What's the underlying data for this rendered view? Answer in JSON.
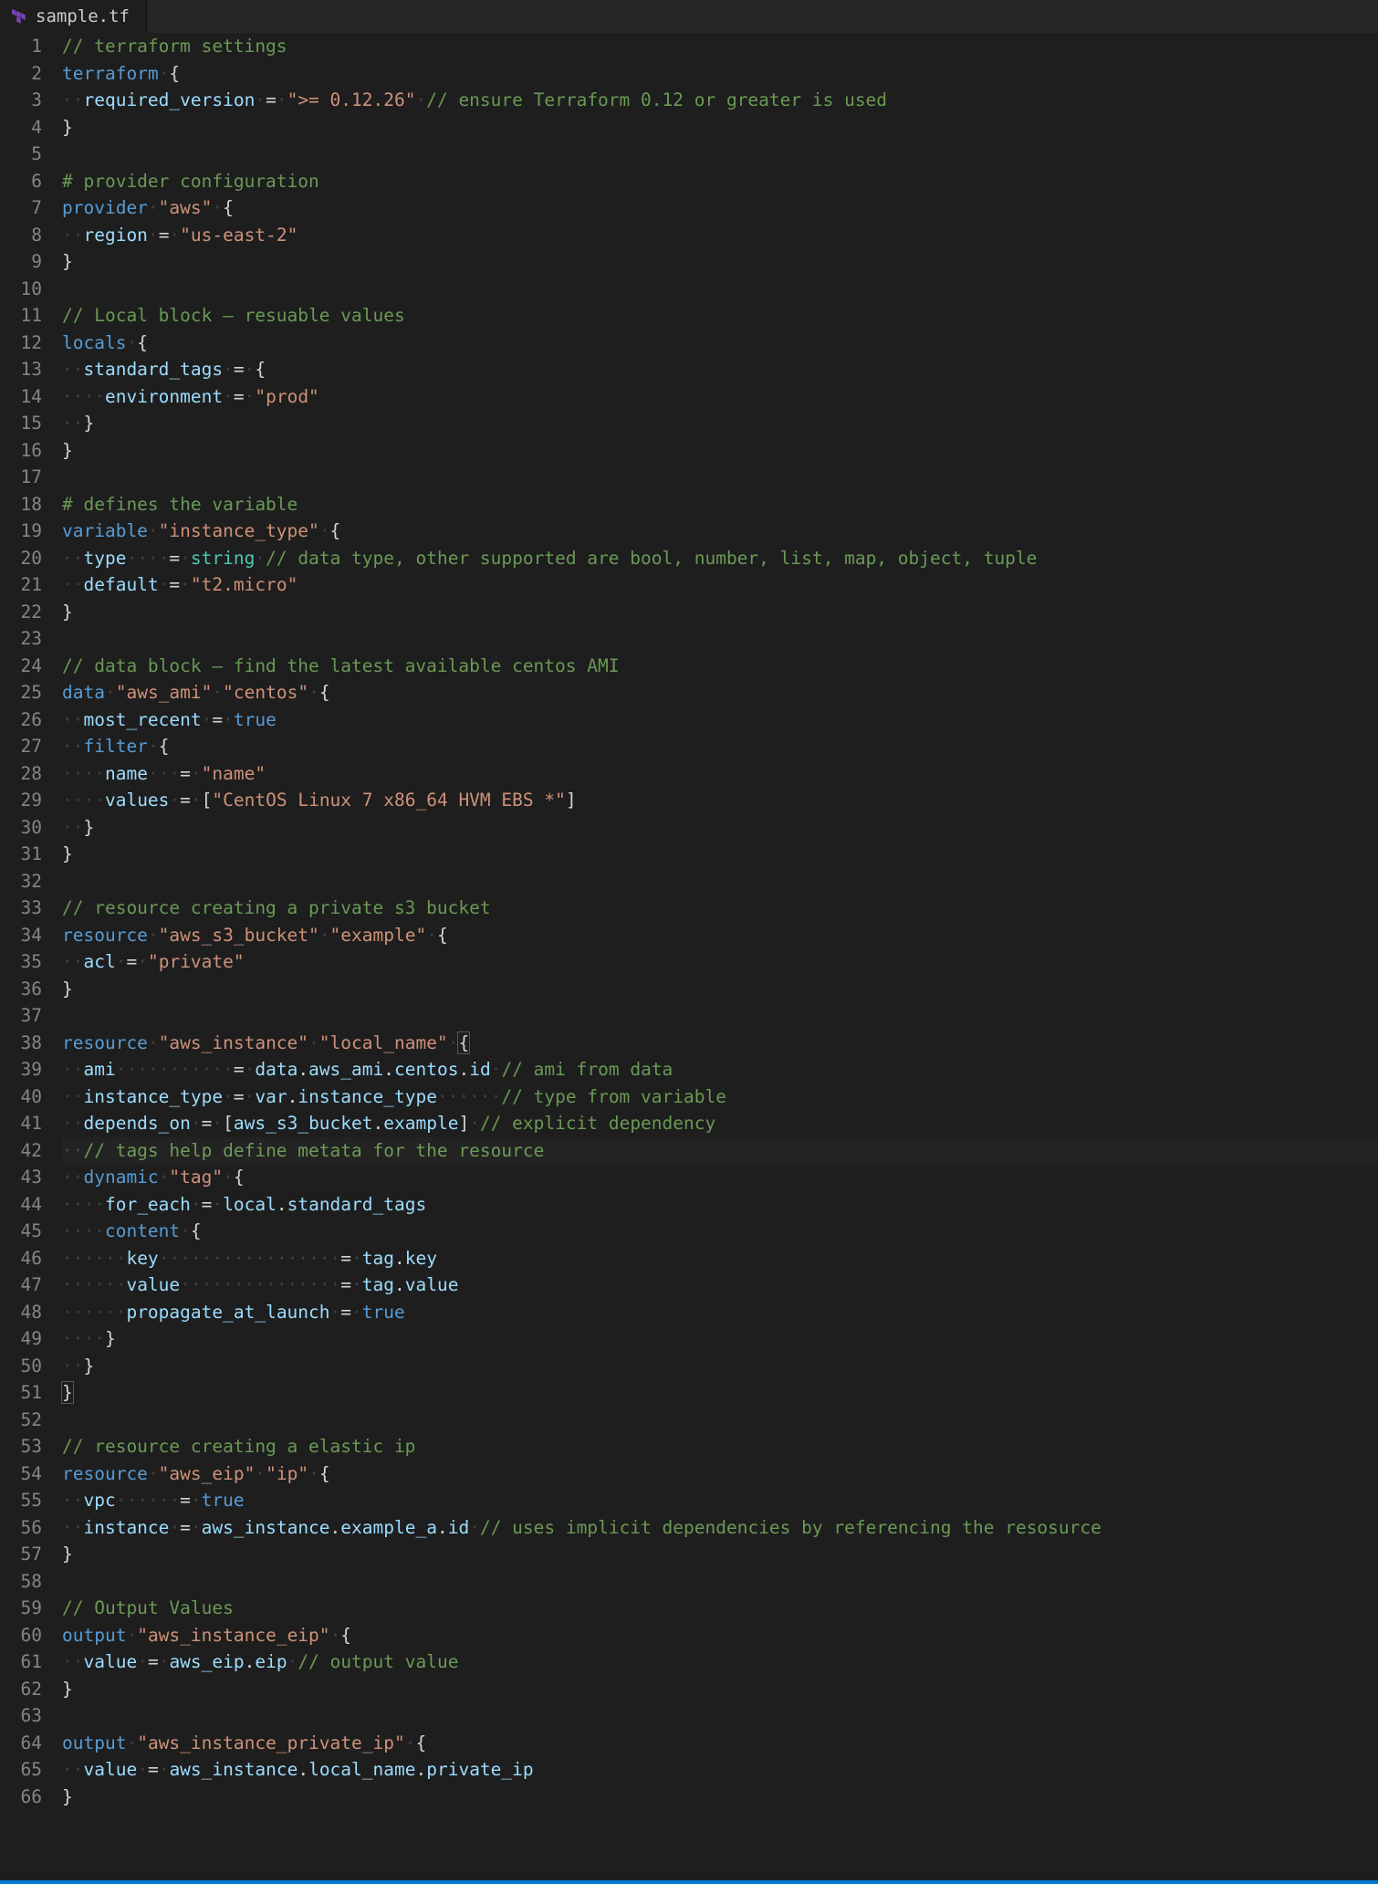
{
  "tab": {
    "filename": "sample.tf"
  },
  "highlight_line": 42,
  "lines": [
    [
      [
        "c-comment",
        "// terraform settings"
      ]
    ],
    [
      [
        "c-keyword",
        "terraform"
      ],
      [
        "ws",
        " "
      ],
      [
        "c-punct",
        "{"
      ]
    ],
    [
      [
        "ws",
        "··"
      ],
      [
        "c-prop",
        "required_version"
      ],
      [
        "ws",
        " "
      ],
      [
        "c-op",
        "="
      ],
      [
        "ws",
        " "
      ],
      [
        "c-string",
        "\">= 0.12.26\""
      ],
      [
        "ws",
        " "
      ],
      [
        "c-comment",
        "// ensure Terraform 0.12 or greater is used"
      ]
    ],
    [
      [
        "c-punct",
        "}"
      ]
    ],
    [
      [
        "",
        ""
      ]
    ],
    [
      [
        "c-comment",
        "# provider configuration"
      ]
    ],
    [
      [
        "c-keyword",
        "provider"
      ],
      [
        "ws",
        " "
      ],
      [
        "c-string",
        "\"aws\""
      ],
      [
        "ws",
        " "
      ],
      [
        "c-punct",
        "{"
      ]
    ],
    [
      [
        "ws",
        "··"
      ],
      [
        "c-prop",
        "region"
      ],
      [
        "ws",
        " "
      ],
      [
        "c-op",
        "="
      ],
      [
        "ws",
        " "
      ],
      [
        "c-string",
        "\"us-east-2\""
      ]
    ],
    [
      [
        "c-punct",
        "}"
      ]
    ],
    [
      [
        "",
        ""
      ]
    ],
    [
      [
        "c-comment",
        "// Local block – resuable values"
      ]
    ],
    [
      [
        "c-keyword",
        "locals"
      ],
      [
        "ws",
        " "
      ],
      [
        "c-punct",
        "{"
      ]
    ],
    [
      [
        "ws",
        "··"
      ],
      [
        "c-prop",
        "standard_tags"
      ],
      [
        "ws",
        " "
      ],
      [
        "c-op",
        "="
      ],
      [
        "ws",
        " "
      ],
      [
        "c-punct",
        "{"
      ]
    ],
    [
      [
        "ws",
        "····"
      ],
      [
        "c-prop",
        "environment"
      ],
      [
        "ws",
        " "
      ],
      [
        "c-op",
        "="
      ],
      [
        "ws",
        " "
      ],
      [
        "c-string",
        "\"prod\""
      ]
    ],
    [
      [
        "ws",
        "··"
      ],
      [
        "c-punct",
        "}"
      ]
    ],
    [
      [
        "c-punct",
        "}"
      ]
    ],
    [
      [
        "",
        ""
      ]
    ],
    [
      [
        "c-comment",
        "# defines the variable"
      ]
    ],
    [
      [
        "c-keyword",
        "variable"
      ],
      [
        "ws",
        " "
      ],
      [
        "c-string",
        "\"instance_type\""
      ],
      [
        "ws",
        " "
      ],
      [
        "c-punct",
        "{"
      ]
    ],
    [
      [
        "ws",
        "··"
      ],
      [
        "c-prop",
        "type"
      ],
      [
        "ws",
        "····"
      ],
      [
        "c-op",
        "="
      ],
      [
        "ws",
        " "
      ],
      [
        "c-type",
        "string"
      ],
      [
        "ws",
        " "
      ],
      [
        "c-comment",
        "// data type, other supported are bool, number, list, map, object, tuple"
      ]
    ],
    [
      [
        "ws",
        "··"
      ],
      [
        "c-prop",
        "default"
      ],
      [
        "ws",
        " "
      ],
      [
        "c-op",
        "="
      ],
      [
        "ws",
        " "
      ],
      [
        "c-string",
        "\"t2.micro\""
      ]
    ],
    [
      [
        "c-punct",
        "}"
      ]
    ],
    [
      [
        "",
        ""
      ]
    ],
    [
      [
        "c-comment",
        "// data block – find the latest available centos AMI"
      ]
    ],
    [
      [
        "c-keyword",
        "data"
      ],
      [
        "ws",
        " "
      ],
      [
        "c-string",
        "\"aws_ami\""
      ],
      [
        "ws",
        " "
      ],
      [
        "c-string",
        "\"centos\""
      ],
      [
        "ws",
        " "
      ],
      [
        "c-punct",
        "{"
      ]
    ],
    [
      [
        "ws",
        "··"
      ],
      [
        "c-prop",
        "most_recent"
      ],
      [
        "ws",
        " "
      ],
      [
        "c-op",
        "="
      ],
      [
        "ws",
        " "
      ],
      [
        "c-bool",
        "true"
      ]
    ],
    [
      [
        "ws",
        "··"
      ],
      [
        "c-keyword",
        "filter"
      ],
      [
        "ws",
        " "
      ],
      [
        "c-punct",
        "{"
      ]
    ],
    [
      [
        "ws",
        "····"
      ],
      [
        "c-prop",
        "name"
      ],
      [
        "ws",
        "···"
      ],
      [
        "c-op",
        "="
      ],
      [
        "ws",
        " "
      ],
      [
        "c-string",
        "\"name\""
      ]
    ],
    [
      [
        "ws",
        "····"
      ],
      [
        "c-prop",
        "values"
      ],
      [
        "ws",
        " "
      ],
      [
        "c-op",
        "="
      ],
      [
        "ws",
        " "
      ],
      [
        "c-punct",
        "["
      ],
      [
        "c-string",
        "\"CentOS Linux 7 x86_64 HVM EBS *\""
      ],
      [
        "c-punct",
        "]"
      ]
    ],
    [
      [
        "ws",
        "··"
      ],
      [
        "c-punct",
        "}"
      ]
    ],
    [
      [
        "c-punct",
        "}"
      ]
    ],
    [
      [
        "",
        ""
      ]
    ],
    [
      [
        "c-comment",
        "// resource creating a private s3 bucket"
      ]
    ],
    [
      [
        "c-keyword",
        "resource"
      ],
      [
        "ws",
        " "
      ],
      [
        "c-string",
        "\"aws_s3_bucket\""
      ],
      [
        "ws",
        " "
      ],
      [
        "c-string",
        "\"example\""
      ],
      [
        "ws",
        " "
      ],
      [
        "c-punct",
        "{"
      ]
    ],
    [
      [
        "ws",
        "··"
      ],
      [
        "c-prop",
        "acl"
      ],
      [
        "ws",
        " "
      ],
      [
        "c-op",
        "="
      ],
      [
        "ws",
        " "
      ],
      [
        "c-string",
        "\"private\""
      ]
    ],
    [
      [
        "c-punct",
        "}"
      ]
    ],
    [
      [
        "",
        ""
      ]
    ],
    [
      [
        "c-keyword",
        "resource"
      ],
      [
        "ws",
        " "
      ],
      [
        "c-string",
        "\"aws_instance\""
      ],
      [
        "ws",
        " "
      ],
      [
        "c-string",
        "\"local_name\""
      ],
      [
        "ws",
        " "
      ],
      [
        "c-punct brmatch",
        "{"
      ]
    ],
    [
      [
        "ws",
        "··"
      ],
      [
        "c-prop",
        "ami"
      ],
      [
        "ws",
        "···········"
      ],
      [
        "c-op",
        "="
      ],
      [
        "ws",
        " "
      ],
      [
        "c-ident",
        "data"
      ],
      [
        "c-punct",
        "."
      ],
      [
        "c-ident",
        "aws_ami"
      ],
      [
        "c-punct",
        "."
      ],
      [
        "c-ident",
        "centos"
      ],
      [
        "c-punct",
        "."
      ],
      [
        "c-ident",
        "id"
      ],
      [
        "ws",
        " "
      ],
      [
        "c-comment",
        "// ami from data"
      ]
    ],
    [
      [
        "ws",
        "··"
      ],
      [
        "c-prop",
        "instance_type"
      ],
      [
        "ws",
        " "
      ],
      [
        "c-op",
        "="
      ],
      [
        "ws",
        " "
      ],
      [
        "c-ident",
        "var"
      ],
      [
        "c-punct",
        "."
      ],
      [
        "c-ident",
        "instance_type"
      ],
      [
        "ws",
        "······"
      ],
      [
        "c-comment",
        "// type from variable"
      ]
    ],
    [
      [
        "ws",
        "··"
      ],
      [
        "c-prop",
        "depends_on"
      ],
      [
        "ws",
        " "
      ],
      [
        "c-op",
        "="
      ],
      [
        "ws",
        " "
      ],
      [
        "c-punct",
        "["
      ],
      [
        "c-ident",
        "aws_s3_bucket"
      ],
      [
        "c-punct",
        "."
      ],
      [
        "c-ident",
        "example"
      ],
      [
        "c-punct",
        "]"
      ],
      [
        "ws",
        " "
      ],
      [
        "c-comment",
        "// explicit dependency"
      ]
    ],
    [
      [
        "ws",
        "··"
      ],
      [
        "c-comment",
        "// tags help define metata for the resource"
      ]
    ],
    [
      [
        "ws",
        "··"
      ],
      [
        "c-keyword",
        "dynamic"
      ],
      [
        "ws",
        " "
      ],
      [
        "c-string",
        "\"tag\""
      ],
      [
        "ws",
        " "
      ],
      [
        "c-punct",
        "{"
      ]
    ],
    [
      [
        "ws",
        "····"
      ],
      [
        "c-prop",
        "for_each"
      ],
      [
        "ws",
        " "
      ],
      [
        "c-op",
        "="
      ],
      [
        "ws",
        " "
      ],
      [
        "c-ident",
        "local"
      ],
      [
        "c-punct",
        "."
      ],
      [
        "c-ident",
        "standard_tags"
      ]
    ],
    [
      [
        "ws",
        "····"
      ],
      [
        "c-keyword",
        "content"
      ],
      [
        "ws",
        " "
      ],
      [
        "c-punct",
        "{"
      ]
    ],
    [
      [
        "ws",
        "······"
      ],
      [
        "c-prop",
        "key"
      ],
      [
        "ws",
        "·················"
      ],
      [
        "c-op",
        "="
      ],
      [
        "ws",
        " "
      ],
      [
        "c-ident",
        "tag"
      ],
      [
        "c-punct",
        "."
      ],
      [
        "c-ident",
        "key"
      ]
    ],
    [
      [
        "ws",
        "······"
      ],
      [
        "c-prop",
        "value"
      ],
      [
        "ws",
        "···············"
      ],
      [
        "c-op",
        "="
      ],
      [
        "ws",
        " "
      ],
      [
        "c-ident",
        "tag"
      ],
      [
        "c-punct",
        "."
      ],
      [
        "c-ident",
        "value"
      ]
    ],
    [
      [
        "ws",
        "······"
      ],
      [
        "c-prop",
        "propagate_at_launch"
      ],
      [
        "ws",
        " "
      ],
      [
        "c-op",
        "="
      ],
      [
        "ws",
        " "
      ],
      [
        "c-bool",
        "true"
      ]
    ],
    [
      [
        "ws",
        "····"
      ],
      [
        "c-punct",
        "}"
      ]
    ],
    [
      [
        "ws",
        "··"
      ],
      [
        "c-punct",
        "}"
      ]
    ],
    [
      [
        "c-punct brmatch",
        "}"
      ]
    ],
    [
      [
        "",
        ""
      ]
    ],
    [
      [
        "c-comment",
        "// resource creating a elastic ip"
      ]
    ],
    [
      [
        "c-keyword",
        "resource"
      ],
      [
        "ws",
        " "
      ],
      [
        "c-string",
        "\"aws_eip\""
      ],
      [
        "ws",
        " "
      ],
      [
        "c-string",
        "\"ip\""
      ],
      [
        "ws",
        " "
      ],
      [
        "c-punct",
        "{"
      ]
    ],
    [
      [
        "ws",
        "··"
      ],
      [
        "c-prop",
        "vpc"
      ],
      [
        "ws",
        "······"
      ],
      [
        "c-op",
        "="
      ],
      [
        "ws",
        " "
      ],
      [
        "c-bool",
        "true"
      ]
    ],
    [
      [
        "ws",
        "··"
      ],
      [
        "c-prop",
        "instance"
      ],
      [
        "ws",
        " "
      ],
      [
        "c-op",
        "="
      ],
      [
        "ws",
        " "
      ],
      [
        "c-ident",
        "aws_instance"
      ],
      [
        "c-punct",
        "."
      ],
      [
        "c-ident",
        "example_a"
      ],
      [
        "c-punct",
        "."
      ],
      [
        "c-ident",
        "id"
      ],
      [
        "ws",
        " "
      ],
      [
        "c-comment",
        "// uses implicit dependencies by referencing the resosurce"
      ]
    ],
    [
      [
        "c-punct",
        "}"
      ]
    ],
    [
      [
        "",
        ""
      ]
    ],
    [
      [
        "c-comment",
        "// Output Values"
      ]
    ],
    [
      [
        "c-keyword",
        "output"
      ],
      [
        "ws",
        " "
      ],
      [
        "c-string",
        "\"aws_instance_eip\""
      ],
      [
        "ws",
        " "
      ],
      [
        "c-punct",
        "{"
      ]
    ],
    [
      [
        "ws",
        "··"
      ],
      [
        "c-prop",
        "value"
      ],
      [
        "ws",
        " "
      ],
      [
        "c-op",
        "="
      ],
      [
        "ws",
        " "
      ],
      [
        "c-ident",
        "aws_eip"
      ],
      [
        "c-punct",
        "."
      ],
      [
        "c-ident",
        "eip"
      ],
      [
        "ws",
        " "
      ],
      [
        "c-comment",
        "// output value"
      ]
    ],
    [
      [
        "c-punct",
        "}"
      ]
    ],
    [
      [
        "",
        ""
      ]
    ],
    [
      [
        "c-keyword",
        "output"
      ],
      [
        "ws",
        " "
      ],
      [
        "c-string",
        "\"aws_instance_private_ip\""
      ],
      [
        "ws",
        " "
      ],
      [
        "c-punct",
        "{"
      ]
    ],
    [
      [
        "ws",
        "··"
      ],
      [
        "c-prop",
        "value"
      ],
      [
        "ws",
        " "
      ],
      [
        "c-op",
        "="
      ],
      [
        "ws",
        " "
      ],
      [
        "c-ident",
        "aws_instance"
      ],
      [
        "c-punct",
        "."
      ],
      [
        "c-ident",
        "local_name"
      ],
      [
        "c-punct",
        "."
      ],
      [
        "c-ident",
        "private_ip"
      ]
    ],
    [
      [
        "c-punct",
        "}"
      ]
    ]
  ]
}
